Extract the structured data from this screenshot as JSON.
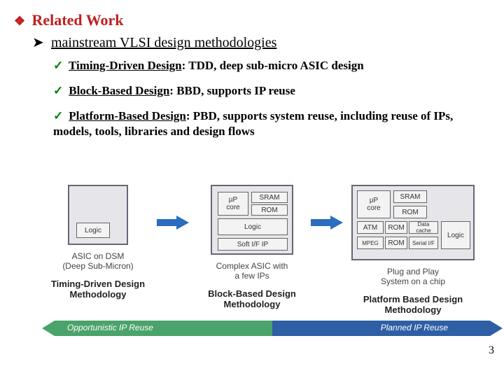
{
  "title": "Related Work",
  "subtitle": "mainstream VLSI design methodologies",
  "bullets": [
    {
      "emph": "Timing-Driven Design",
      "rest": ": TDD,  deep sub-micro ASIC design"
    },
    {
      "emph": "Block-Based Design",
      "rest": ": BBD, supports IP reuse"
    },
    {
      "emph": "Platform-Based Design",
      "rest": ": PBD, supports system reuse, including reuse of IPs, models, tools, libraries and design flows"
    }
  ],
  "diagram": {
    "cols": [
      {
        "chip_blocks": {
          "Logic": "Logic"
        },
        "caption1_a": "ASIC on DSM",
        "caption1_b": "(Deep Sub-Micron)",
        "caption2_a": "Timing-Driven Design",
        "caption2_b": "Methodology"
      },
      {
        "chip_blocks": {
          "uP": "µP\ncore",
          "SRAM": "SRAM",
          "ROM": "ROM",
          "Logic": "Logic",
          "SoftIP": "Soft I/F IP"
        },
        "caption1_a": "Complex ASIC with",
        "caption1_b": "a few IPs",
        "caption2_a": "Block-Based Design",
        "caption2_b": "Methodology"
      },
      {
        "chip_blocks": {
          "uP": "µP\ncore",
          "SRAM": "SRAM",
          "ROM1": "ROM",
          "ATM": "ATM",
          "ROM2": "ROM",
          "Data": "Data\ncache",
          "MPEG": "MPEG",
          "ROM3": "ROM",
          "Serial": "Serial I/F",
          "Logic": "Logic"
        },
        "caption1_a": "Plug and Play",
        "caption1_b": "System on a chip",
        "caption2_a": "Platform Based Design",
        "caption2_b": "Methodology"
      }
    ],
    "reuse_left": "Opportunistic IP Reuse",
    "reuse_right": "Planned IP Reuse"
  },
  "page_number": "3"
}
